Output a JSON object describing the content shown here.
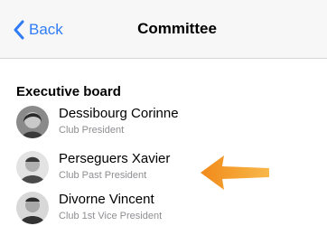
{
  "navbar": {
    "back_label": "Back",
    "title": "Committee"
  },
  "section": {
    "title": "Executive board"
  },
  "members": [
    {
      "name": "Dessibourg Corinne",
      "role": "Club President"
    },
    {
      "name": "Perseguers Xavier",
      "role": "Club Past President"
    },
    {
      "name": "Divorne Vincent",
      "role": "Club 1st Vice President"
    }
  ],
  "colors": {
    "accent": "#2f7cf6",
    "annotation_arrow": "#f5a623"
  }
}
